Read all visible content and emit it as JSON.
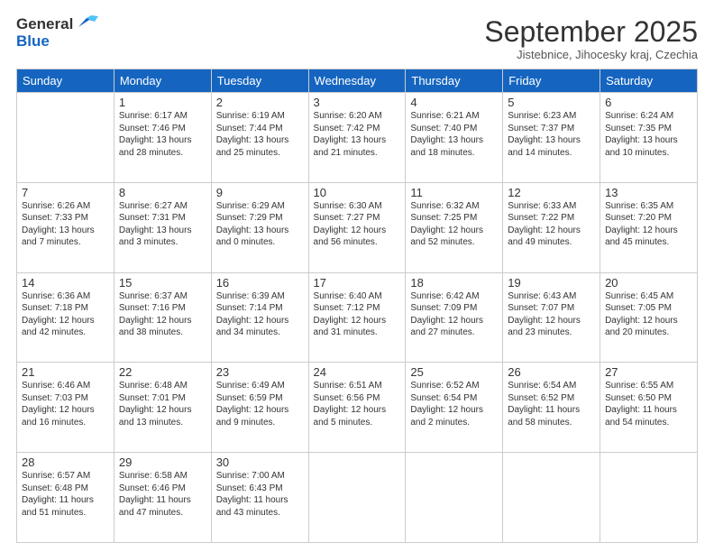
{
  "header": {
    "logo_line1": "General",
    "logo_line2": "Blue",
    "month_title": "September 2025",
    "location": "Jistebnice, Jihocesky kraj, Czechia"
  },
  "weekdays": [
    "Sunday",
    "Monday",
    "Tuesday",
    "Wednesday",
    "Thursday",
    "Friday",
    "Saturday"
  ],
  "weeks": [
    [
      {
        "day": "",
        "content": ""
      },
      {
        "day": "1",
        "content": "Sunrise: 6:17 AM\nSunset: 7:46 PM\nDaylight: 13 hours\nand 28 minutes."
      },
      {
        "day": "2",
        "content": "Sunrise: 6:19 AM\nSunset: 7:44 PM\nDaylight: 13 hours\nand 25 minutes."
      },
      {
        "day": "3",
        "content": "Sunrise: 6:20 AM\nSunset: 7:42 PM\nDaylight: 13 hours\nand 21 minutes."
      },
      {
        "day": "4",
        "content": "Sunrise: 6:21 AM\nSunset: 7:40 PM\nDaylight: 13 hours\nand 18 minutes."
      },
      {
        "day": "5",
        "content": "Sunrise: 6:23 AM\nSunset: 7:37 PM\nDaylight: 13 hours\nand 14 minutes."
      },
      {
        "day": "6",
        "content": "Sunrise: 6:24 AM\nSunset: 7:35 PM\nDaylight: 13 hours\nand 10 minutes."
      }
    ],
    [
      {
        "day": "7",
        "content": "Sunrise: 6:26 AM\nSunset: 7:33 PM\nDaylight: 13 hours\nand 7 minutes."
      },
      {
        "day": "8",
        "content": "Sunrise: 6:27 AM\nSunset: 7:31 PM\nDaylight: 13 hours\nand 3 minutes."
      },
      {
        "day": "9",
        "content": "Sunrise: 6:29 AM\nSunset: 7:29 PM\nDaylight: 13 hours\nand 0 minutes."
      },
      {
        "day": "10",
        "content": "Sunrise: 6:30 AM\nSunset: 7:27 PM\nDaylight: 12 hours\nand 56 minutes."
      },
      {
        "day": "11",
        "content": "Sunrise: 6:32 AM\nSunset: 7:25 PM\nDaylight: 12 hours\nand 52 minutes."
      },
      {
        "day": "12",
        "content": "Sunrise: 6:33 AM\nSunset: 7:22 PM\nDaylight: 12 hours\nand 49 minutes."
      },
      {
        "day": "13",
        "content": "Sunrise: 6:35 AM\nSunset: 7:20 PM\nDaylight: 12 hours\nand 45 minutes."
      }
    ],
    [
      {
        "day": "14",
        "content": "Sunrise: 6:36 AM\nSunset: 7:18 PM\nDaylight: 12 hours\nand 42 minutes."
      },
      {
        "day": "15",
        "content": "Sunrise: 6:37 AM\nSunset: 7:16 PM\nDaylight: 12 hours\nand 38 minutes."
      },
      {
        "day": "16",
        "content": "Sunrise: 6:39 AM\nSunset: 7:14 PM\nDaylight: 12 hours\nand 34 minutes."
      },
      {
        "day": "17",
        "content": "Sunrise: 6:40 AM\nSunset: 7:12 PM\nDaylight: 12 hours\nand 31 minutes."
      },
      {
        "day": "18",
        "content": "Sunrise: 6:42 AM\nSunset: 7:09 PM\nDaylight: 12 hours\nand 27 minutes."
      },
      {
        "day": "19",
        "content": "Sunrise: 6:43 AM\nSunset: 7:07 PM\nDaylight: 12 hours\nand 23 minutes."
      },
      {
        "day": "20",
        "content": "Sunrise: 6:45 AM\nSunset: 7:05 PM\nDaylight: 12 hours\nand 20 minutes."
      }
    ],
    [
      {
        "day": "21",
        "content": "Sunrise: 6:46 AM\nSunset: 7:03 PM\nDaylight: 12 hours\nand 16 minutes."
      },
      {
        "day": "22",
        "content": "Sunrise: 6:48 AM\nSunset: 7:01 PM\nDaylight: 12 hours\nand 13 minutes."
      },
      {
        "day": "23",
        "content": "Sunrise: 6:49 AM\nSunset: 6:59 PM\nDaylight: 12 hours\nand 9 minutes."
      },
      {
        "day": "24",
        "content": "Sunrise: 6:51 AM\nSunset: 6:56 PM\nDaylight: 12 hours\nand 5 minutes."
      },
      {
        "day": "25",
        "content": "Sunrise: 6:52 AM\nSunset: 6:54 PM\nDaylight: 12 hours\nand 2 minutes."
      },
      {
        "day": "26",
        "content": "Sunrise: 6:54 AM\nSunset: 6:52 PM\nDaylight: 11 hours\nand 58 minutes."
      },
      {
        "day": "27",
        "content": "Sunrise: 6:55 AM\nSunset: 6:50 PM\nDaylight: 11 hours\nand 54 minutes."
      }
    ],
    [
      {
        "day": "28",
        "content": "Sunrise: 6:57 AM\nSunset: 6:48 PM\nDaylight: 11 hours\nand 51 minutes."
      },
      {
        "day": "29",
        "content": "Sunrise: 6:58 AM\nSunset: 6:46 PM\nDaylight: 11 hours\nand 47 minutes."
      },
      {
        "day": "30",
        "content": "Sunrise: 7:00 AM\nSunset: 6:43 PM\nDaylight: 11 hours\nand 43 minutes."
      },
      {
        "day": "",
        "content": ""
      },
      {
        "day": "",
        "content": ""
      },
      {
        "day": "",
        "content": ""
      },
      {
        "day": "",
        "content": ""
      }
    ]
  ]
}
